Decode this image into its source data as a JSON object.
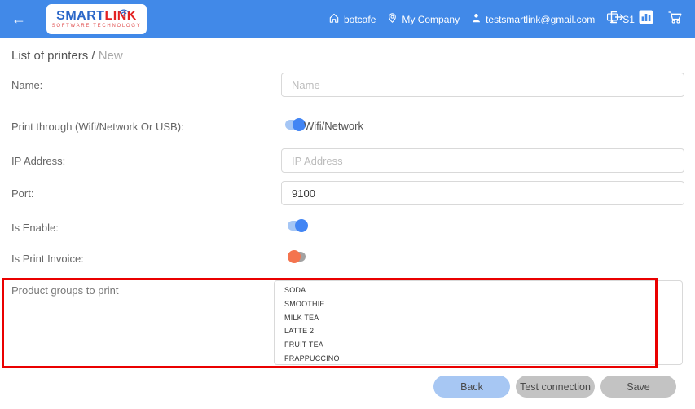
{
  "header": {
    "back_arrow": "←",
    "logo": {
      "brand_primary": "SMART",
      "brand_secondary": "LINK",
      "subtitle": "SOFTWARE TECHNOLOGY"
    },
    "nav": [
      {
        "icon": "home-icon",
        "label": "botcafe"
      },
      {
        "icon": "location-pin-icon",
        "label": "My Company"
      },
      {
        "icon": "user-icon",
        "label": "testsmartlink@gmail.com"
      },
      {
        "icon": "monitor-icon",
        "label": "S1"
      }
    ],
    "action_icons": [
      "logout-icon",
      "bar-chart-icon",
      "cart-icon"
    ]
  },
  "breadcrumb": {
    "current": "List of printers /",
    "page": "New"
  },
  "form": {
    "name": {
      "label": "Name:",
      "placeholder": "Name",
      "value": ""
    },
    "print_through": {
      "label": "Print through (Wifi/Network Or USB):",
      "state": "on",
      "toggle_label": "Wifi/Network"
    },
    "ip_address": {
      "label": "IP Address:",
      "placeholder": "IP Address",
      "value": ""
    },
    "port": {
      "label": "Port:",
      "value": "9100"
    },
    "is_enable": {
      "label": "Is Enable:",
      "state": "on"
    },
    "is_print_invoice": {
      "label": "Is Print Invoice:",
      "state": "off"
    },
    "product_groups": {
      "label": "Product groups to print",
      "options": [
        "SODA",
        "SMOOTHIE",
        "MILK TEA",
        "LATTE 2",
        "FRUIT TEA",
        "FRAPPUCCINO"
      ]
    }
  },
  "buttons": {
    "back": "Back",
    "test_connection": "Test connection",
    "save": "Save"
  },
  "annotation": {
    "type": "highlight-rectangle",
    "color": "#ea0000"
  },
  "colors": {
    "header_background": "#4189e8",
    "toggle_on_knob": "#4285f4",
    "toggle_on_track": "#a5c6f5",
    "toggle_off_knob": "#f4744e",
    "toggle_off_track": "#a2a2a2",
    "back_button": "#a7c7f3",
    "gray_button": "#c3c3c3",
    "brand_blue": "#2a66c8",
    "brand_red": "#e32222"
  }
}
